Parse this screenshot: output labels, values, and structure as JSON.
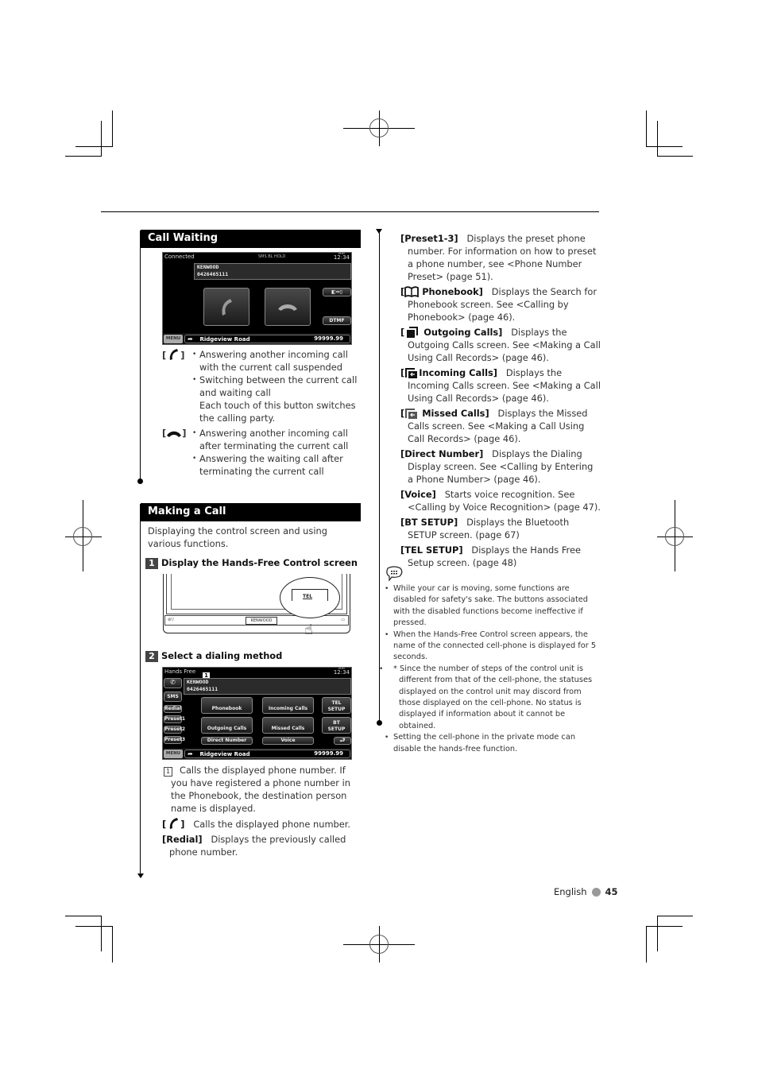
{
  "sections": {
    "call_waiting": {
      "title": "Call Waiting",
      "screen": {
        "status_label": "Connected",
        "status_icons": "SMS BL HOLD",
        "time_ampm": "AM",
        "time": "12:34",
        "caller_name": "KENWOOD",
        "caller_number": "0426465111",
        "answer_button": "phone-answer",
        "hangup_button": "phone-hangup",
        "switch_button": "switch-audio",
        "dtmf_label": "DTMF",
        "menu_label": "MENU",
        "road": "Ridgeview Road",
        "distance": "99999.99"
      },
      "items": [
        {
          "icon": "phone-answer-icon",
          "bullets": [
            "Answering another incoming call with the current call suspended",
            "Switching between the current call and waiting call",
            "Each touch of this button switches the calling party."
          ]
        },
        {
          "icon": "phone-hangup-icon",
          "bullets": [
            "Answering another incoming call after terminating the current call",
            "Answering the waiting call after terminating the current call"
          ]
        }
      ]
    },
    "making_a_call": {
      "title": "Making a Call",
      "intro": "Displaying the control screen and using various functions.",
      "step1": {
        "num": "1",
        "label": "Display the Hands-Free Control screen",
        "tel_label": "TEL",
        "brand": "KENWOOD"
      },
      "step2": {
        "num": "2",
        "label": "Select a dialing method"
      },
      "screen": {
        "status_label": "Hands Free",
        "callout": "1",
        "time_ampm": "AM",
        "time": "12:34",
        "caller_name": "KENWOOD",
        "caller_number": "0426465111",
        "left_buttons": [
          "SMS",
          "Redial",
          "Preset1",
          "Preset2",
          "Preset3"
        ],
        "grid_buttons": [
          "Phonebook",
          "Incoming Calls",
          "Outgoing Calls",
          "Missed Calls",
          "Direct Number",
          "Voice"
        ],
        "right_buttons": [
          "TEL SETUP",
          "BT SETUP"
        ],
        "menu_label": "MENU",
        "road": "Ridgeview Road",
        "distance": "99999.99"
      },
      "descriptions": [
        {
          "key": "1",
          "text": "Calls the displayed phone number. If you have registered a phone number in the Phonebook, the destination person name is displayed."
        },
        {
          "key": "[phone]",
          "text": "Calls the displayed phone number."
        },
        {
          "key": "[Redial]",
          "text": "Displays the previously called phone number."
        }
      ]
    },
    "right_column": {
      "items": [
        {
          "key": "[Preset1-3]",
          "text": "Displays the preset phone number. For information on how to preset a phone number, see <Phone Number Preset> (page 51)."
        },
        {
          "key": "Phonebook]",
          "icon": "phonebook-icon",
          "text": "Displays the Search for Phonebook screen. See <Calling by Phonebook> (page 46)."
        },
        {
          "key": "Outgoing Calls]",
          "icon": "outgoing-calls-icon",
          "text": "Displays the Outgoing Calls screen. See <Making a Call Using Call Records> (page 46)."
        },
        {
          "key": "Incoming Calls]",
          "icon": "incoming-calls-icon",
          "text": "Displays the Incoming Calls screen. See <Making a Call Using Call Records> (page 46)."
        },
        {
          "key": "Missed Calls]",
          "icon": "missed-calls-icon",
          "text": "Displays the Missed Calls screen. See <Making a Call Using Call Records> (page 46)."
        },
        {
          "key": "[Direct Number]",
          "text": "Displays the Dialing Display screen. See <Calling by Entering a Phone Number> (page 46)."
        },
        {
          "key": "[Voice]",
          "text": "Starts voice recognition. See <Calling by Voice Recognition> (page 47)."
        },
        {
          "key": "[BT SETUP]",
          "text": "Displays the Bluetooth SETUP screen. (page 67)"
        },
        {
          "key": "[TEL SETUP]",
          "text": "Displays the Hands Free Setup screen. (page 48)"
        }
      ],
      "notes": [
        "While your car is moving, some functions are disabled for safety's sake. The buttons associated with the disabled functions become ineffective if pressed.",
        "When the Hands-Free Control screen appears, the name of the connected cell-phone is displayed for 5 seconds.",
        "* Since the number of steps of the control unit is different from that of the cell-phone, the statuses displayed on the control unit may discord from those displayed on the cell-phone. No status is displayed if information about it cannot be obtained.",
        "Setting the cell-phone in the private mode can disable the hands-free function."
      ]
    }
  },
  "footer": {
    "language": "English",
    "page": "45"
  }
}
